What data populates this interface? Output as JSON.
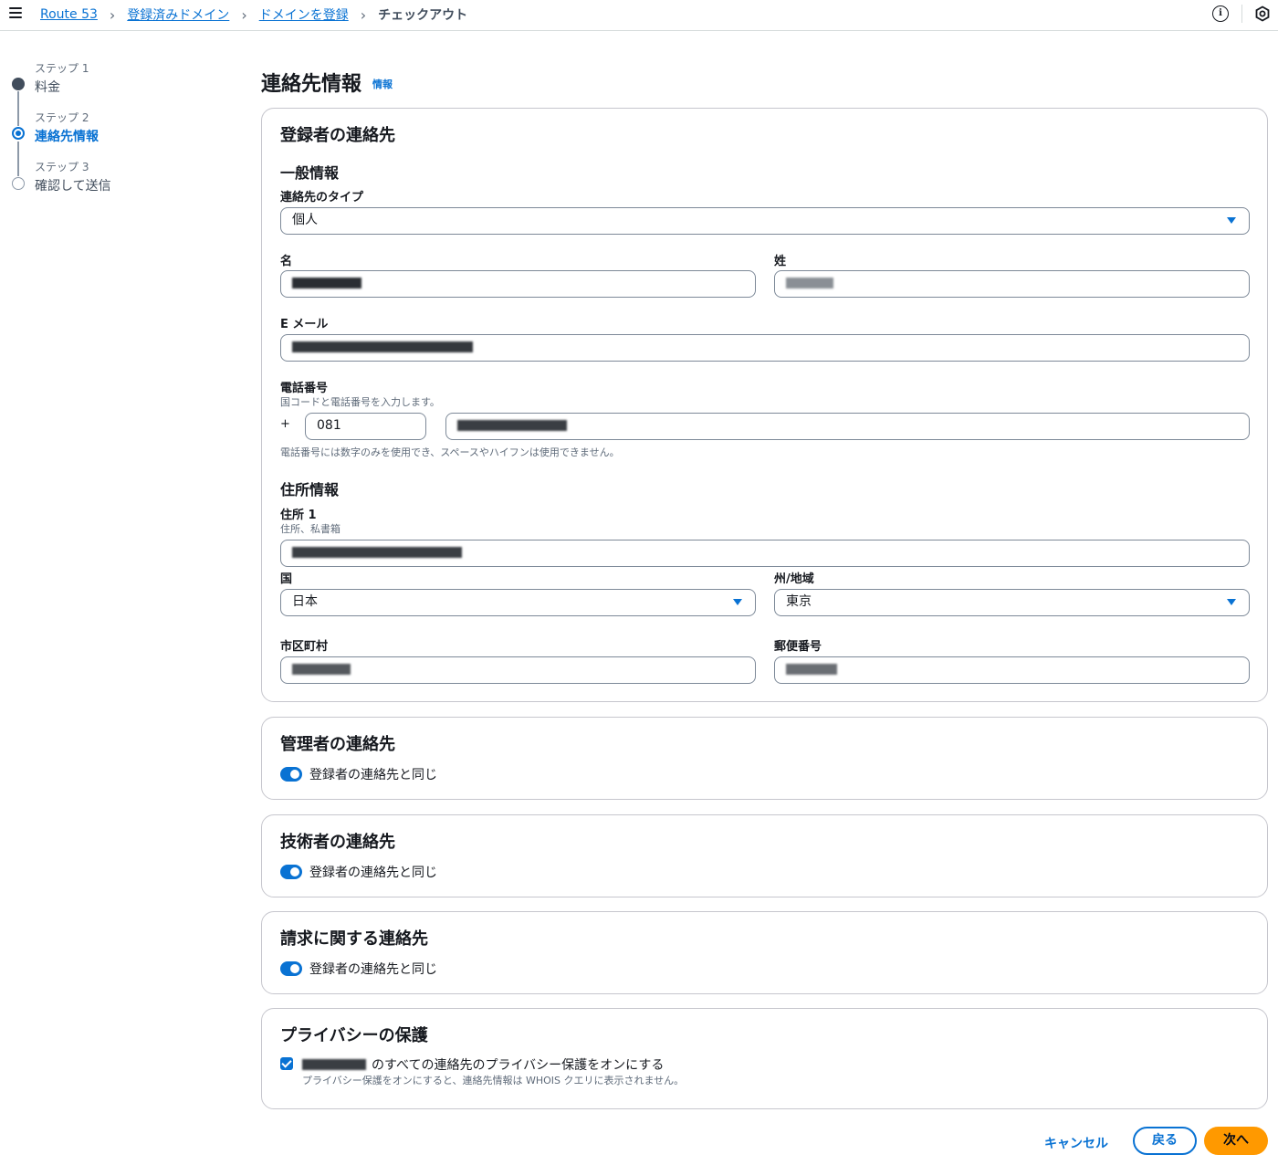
{
  "breadcrumbs": {
    "route53": "Route 53",
    "registered_domains": "登録済みドメイン",
    "register_domain": "ドメインを登録",
    "current": "チェックアウト"
  },
  "icons": {
    "menu": "hamburger-menu-icon",
    "info": "info-icon",
    "notifications": "hexagon-icon",
    "accent_color": "#0972d3",
    "primary_button_color": "#ff9900"
  },
  "steps": [
    {
      "number": "ステップ 1",
      "label": "料金",
      "state": "done"
    },
    {
      "number": "ステップ 2",
      "label": "連絡先情報",
      "state": "active"
    },
    {
      "number": "ステップ 3",
      "label": "確認して送信",
      "state": "todo"
    }
  ],
  "page": {
    "title": "連絡先情報",
    "info_link": "情報"
  },
  "registrant": {
    "title": "登録者の連絡先",
    "general_heading": "一般情報",
    "contact_type": {
      "label": "連絡先のタイプ",
      "value": "個人"
    },
    "first_name": {
      "label": "名"
    },
    "last_name": {
      "label": "姓"
    },
    "email": {
      "label": "E メール"
    },
    "phone": {
      "label": "電話番号",
      "description": "国コードと電話番号を入力します。",
      "plus": "+",
      "country_code": "081",
      "hint": "電話番号には数字のみを使用でき、スペースやハイフンは使用できません。"
    },
    "address_heading": "住所情報",
    "address1": {
      "label": "住所 1",
      "description": "住所、私書箱"
    },
    "country": {
      "label": "国",
      "value": "日本"
    },
    "state": {
      "label": "州/地域",
      "value": "東京"
    },
    "city": {
      "label": "市区町村"
    },
    "postal_code": {
      "label": "郵便番号"
    }
  },
  "admin": {
    "title": "管理者の連絡先",
    "toggle_label": "登録者の連絡先と同じ",
    "checked": true
  },
  "tech": {
    "title": "技術者の連絡先",
    "toggle_label": "登録者の連絡先と同じ",
    "checked": true
  },
  "billing": {
    "title": "請求に関する連絡先",
    "toggle_label": "登録者の連絡先と同じ",
    "checked": true
  },
  "privacy": {
    "title": "プライバシーの保護",
    "checkbox_label": "のすべての連絡先のプライバシー保護をオンにする",
    "checkbox_desc": "プライバシー保護をオンにすると、連絡先情報は WHOIS クエリに表示されません。",
    "checked": true
  },
  "footer": {
    "cancel": "キャンセル",
    "back": "戻る",
    "next": "次へ"
  }
}
